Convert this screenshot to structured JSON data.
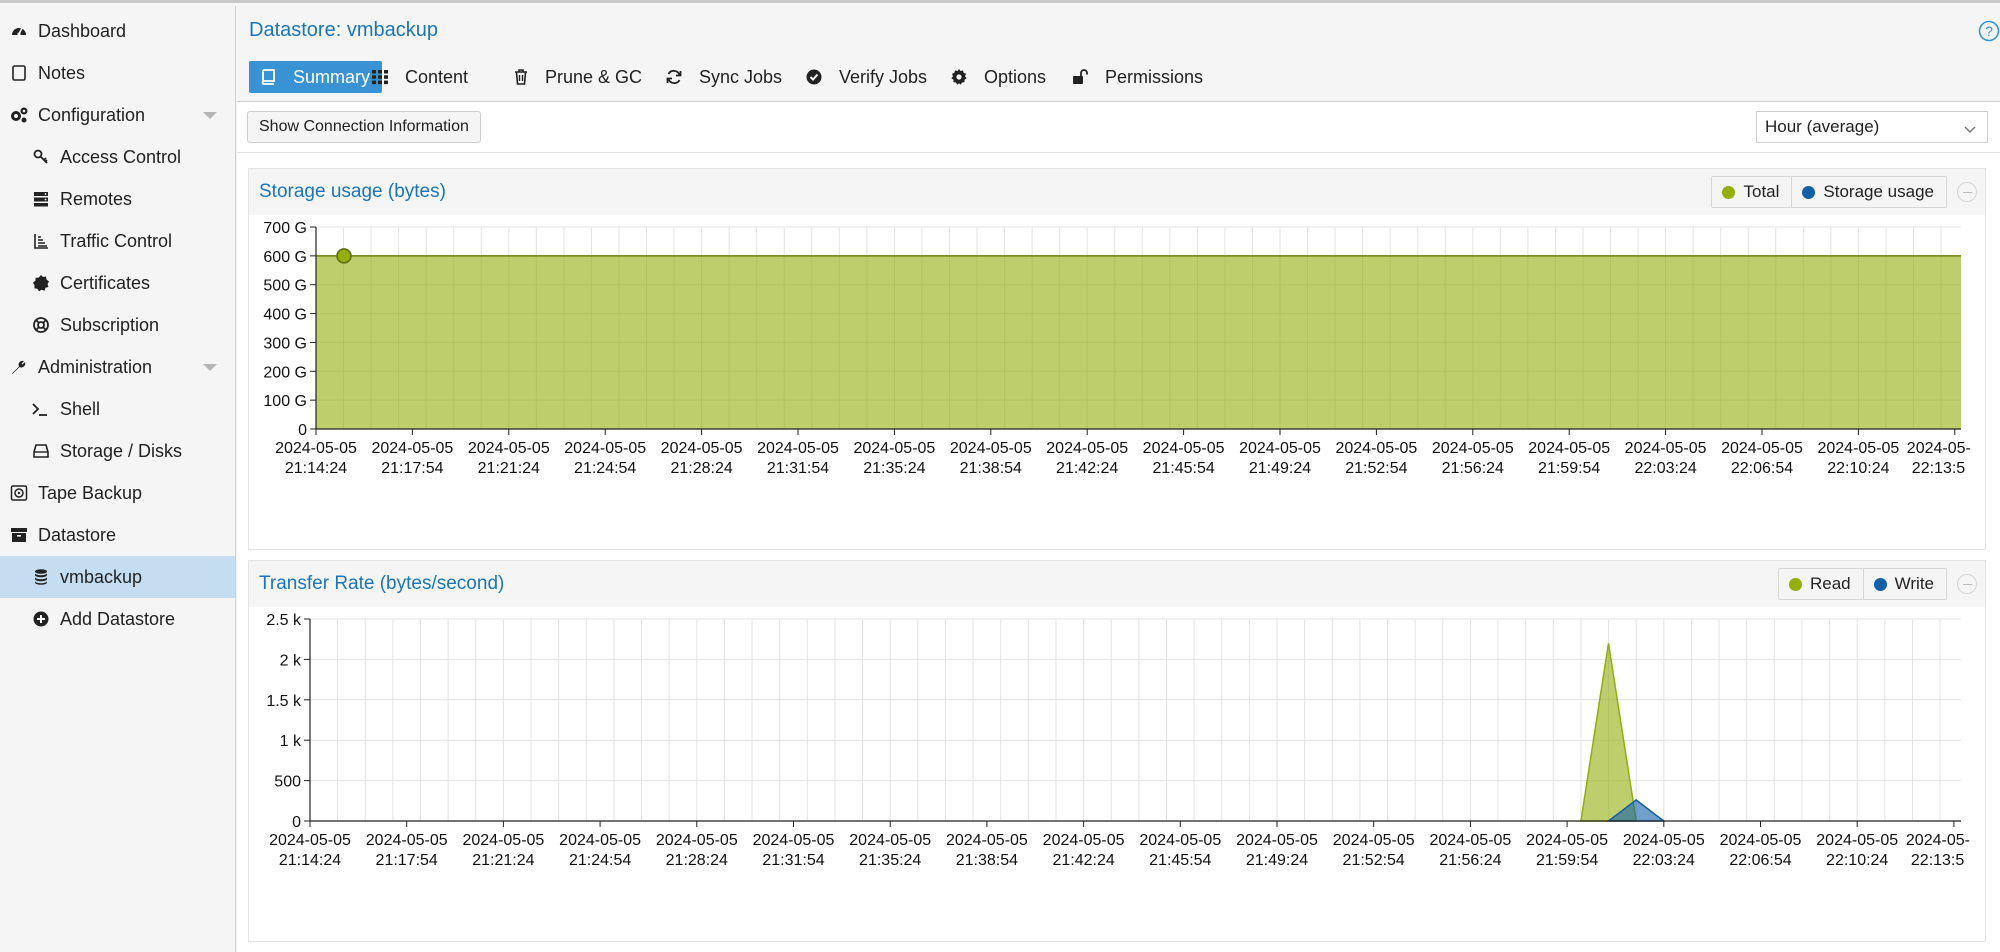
{
  "sidebar": {
    "items": [
      {
        "label": "Dashboard",
        "icon": "dashboard-icon",
        "indent": 0
      },
      {
        "label": "Notes",
        "icon": "notes-icon",
        "indent": 0
      },
      {
        "label": "Configuration",
        "icon": "gears-icon",
        "indent": 0,
        "expandable": true
      },
      {
        "label": "Access Control",
        "icon": "key-icon",
        "indent": 1
      },
      {
        "label": "Remotes",
        "icon": "server-icon",
        "indent": 1
      },
      {
        "label": "Traffic Control",
        "icon": "traffic-icon",
        "indent": 1
      },
      {
        "label": "Certificates",
        "icon": "certificate-icon",
        "indent": 1
      },
      {
        "label": "Subscription",
        "icon": "lifebuoy-icon",
        "indent": 1
      },
      {
        "label": "Administration",
        "icon": "wrench-icon",
        "indent": 0,
        "expandable": true
      },
      {
        "label": "Shell",
        "icon": "terminal-icon",
        "indent": 1
      },
      {
        "label": "Storage / Disks",
        "icon": "hdd-icon",
        "indent": 1
      },
      {
        "label": "Tape Backup",
        "icon": "tape-icon",
        "indent": 0
      },
      {
        "label": "Datastore",
        "icon": "archive-icon",
        "indent": 0
      },
      {
        "label": "vmbackup",
        "icon": "database-icon",
        "indent": 1,
        "selected": true
      },
      {
        "label": "Add Datastore",
        "icon": "plus-circle-icon",
        "indent": 1
      }
    ]
  },
  "header": {
    "title": "Datastore: vmbackup",
    "tabs": [
      {
        "label": "Summary",
        "icon": "book-icon",
        "active": true
      },
      {
        "label": "Content",
        "icon": "grid-icon"
      },
      {
        "label": "Prune & GC",
        "icon": "trash-icon"
      },
      {
        "label": "Sync Jobs",
        "icon": "refresh-icon"
      },
      {
        "label": "Verify Jobs",
        "icon": "check-circle-icon"
      },
      {
        "label": "Options",
        "icon": "gear-icon"
      },
      {
        "label": "Permissions",
        "icon": "unlock-icon"
      }
    ]
  },
  "toolbar": {
    "connection_button": "Show Connection Information",
    "timeframe": "Hour (average)"
  },
  "colors": {
    "accent": "#3892d3",
    "title_blue": "#1a75bc",
    "series_green": "#94ae0a",
    "series_blue": "#115fa6"
  },
  "chart_data": [
    {
      "type": "area",
      "title": "Storage usage (bytes)",
      "y_ticks": [
        "0",
        "100 G",
        "200 G",
        "300 G",
        "400 G",
        "500 G",
        "600 G",
        "700 G"
      ],
      "ylim": [
        0,
        700
      ],
      "x_ticks": [
        [
          "2024-05-05",
          "21:14:24"
        ],
        [
          "2024-05-05",
          "21:17:54"
        ],
        [
          "2024-05-05",
          "21:21:24"
        ],
        [
          "2024-05-05",
          "21:24:54"
        ],
        [
          "2024-05-05",
          "21:28:24"
        ],
        [
          "2024-05-05",
          "21:31:54"
        ],
        [
          "2024-05-05",
          "21:35:24"
        ],
        [
          "2024-05-05",
          "21:38:54"
        ],
        [
          "2024-05-05",
          "21:42:24"
        ],
        [
          "2024-05-05",
          "21:45:54"
        ],
        [
          "2024-05-05",
          "21:49:24"
        ],
        [
          "2024-05-05",
          "21:52:54"
        ],
        [
          "2024-05-05",
          "21:56:24"
        ],
        [
          "2024-05-05",
          "21:59:54"
        ],
        [
          "2024-05-05",
          "22:03:24"
        ],
        [
          "2024-05-05",
          "22:06:54"
        ],
        [
          "2024-05-05",
          "22:10:24"
        ],
        [
          "2024-05-",
          "22:13:5"
        ]
      ],
      "legend": [
        {
          "name": "Total",
          "color": "#94ae0a"
        },
        {
          "name": "Storage usage",
          "color": "#115fa6"
        }
      ],
      "series": [
        {
          "name": "Total",
          "values": [
            600,
            600
          ]
        }
      ],
      "grid": true
    },
    {
      "type": "area",
      "title": "Transfer Rate (bytes/second)",
      "y_ticks": [
        "0",
        "500",
        "1 k",
        "1.5 k",
        "2 k",
        "2.5 k"
      ],
      "ylim": [
        0,
        2500
      ],
      "x_ticks": [
        [
          "2024-05-05",
          "21:14:24"
        ],
        [
          "2024-05-05",
          "21:17:54"
        ],
        [
          "2024-05-05",
          "21:21:24"
        ],
        [
          "2024-05-05",
          "21:24:54"
        ],
        [
          "2024-05-05",
          "21:28:24"
        ],
        [
          "2024-05-05",
          "21:31:54"
        ],
        [
          "2024-05-05",
          "21:35:24"
        ],
        [
          "2024-05-05",
          "21:38:54"
        ],
        [
          "2024-05-05",
          "21:42:24"
        ],
        [
          "2024-05-05",
          "21:45:54"
        ],
        [
          "2024-05-05",
          "21:49:24"
        ],
        [
          "2024-05-05",
          "21:52:54"
        ],
        [
          "2024-05-05",
          "21:56:24"
        ],
        [
          "2024-05-05",
          "21:59:54"
        ],
        [
          "2024-05-05",
          "22:03:24"
        ],
        [
          "2024-05-05",
          "22:06:54"
        ],
        [
          "2024-05-05",
          "22:10:24"
        ],
        [
          "2024-05-",
          "22:13:5"
        ]
      ],
      "legend": [
        {
          "name": "Read",
          "color": "#94ae0a"
        },
        {
          "name": "Write",
          "color": "#115fa6"
        }
      ],
      "series": [
        {
          "name": "Read",
          "points": [
            [
              "2024-05-05 22:00:24",
              0
            ],
            [
              "2024-05-05 22:01:24",
              2200
            ],
            [
              "2024-05-05 22:02:24",
              0
            ]
          ]
        },
        {
          "name": "Write",
          "points": [
            [
              "2024-05-05 22:01:24",
              0
            ],
            [
              "2024-05-05 22:02:24",
              260
            ],
            [
              "2024-05-05 22:03:24",
              0
            ]
          ]
        }
      ],
      "grid": true
    }
  ]
}
